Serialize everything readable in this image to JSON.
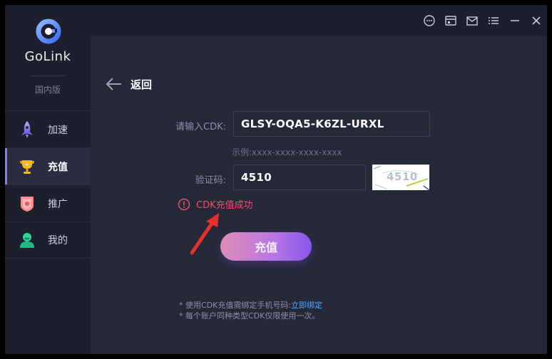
{
  "app": {
    "name": "GoLink",
    "edition": "国内版"
  },
  "nav": {
    "items": [
      {
        "label": "加速",
        "icon": "rocket-icon",
        "active": false
      },
      {
        "label": "充值",
        "icon": "trophy-icon",
        "active": true
      },
      {
        "label": "推广",
        "icon": "shield-badge-icon",
        "active": false
      },
      {
        "label": "我的",
        "icon": "user-icon",
        "active": false
      }
    ]
  },
  "titlebar": {
    "icons": [
      "chat-icon",
      "shop-icon",
      "mail-icon",
      "menu-icon",
      "minimize-icon",
      "close-icon"
    ]
  },
  "page": {
    "back_label": "返回",
    "cdk_label": "请输入CDK:",
    "cdk_value": "GLSY-OQA5-K6ZL-URXL",
    "cdk_example": "示例:xxxx-xxxx-xxxx-xxxx",
    "captcha_label": "验证码:",
    "captcha_value": "4510",
    "captcha_image_text": "4510",
    "status_message": "CDK充值成功",
    "submit_label": "充值",
    "note1_prefix": "* 使用CDK充值需绑定手机号码:",
    "note1_link": "立即绑定",
    "note2": "* 每个账户同种类型CDK仅限使用一次。"
  },
  "colors": {
    "accent": "#8a7cf0",
    "error": "#f0506e",
    "link": "#58a6ff",
    "annotation_arrow": "#e8302a"
  }
}
